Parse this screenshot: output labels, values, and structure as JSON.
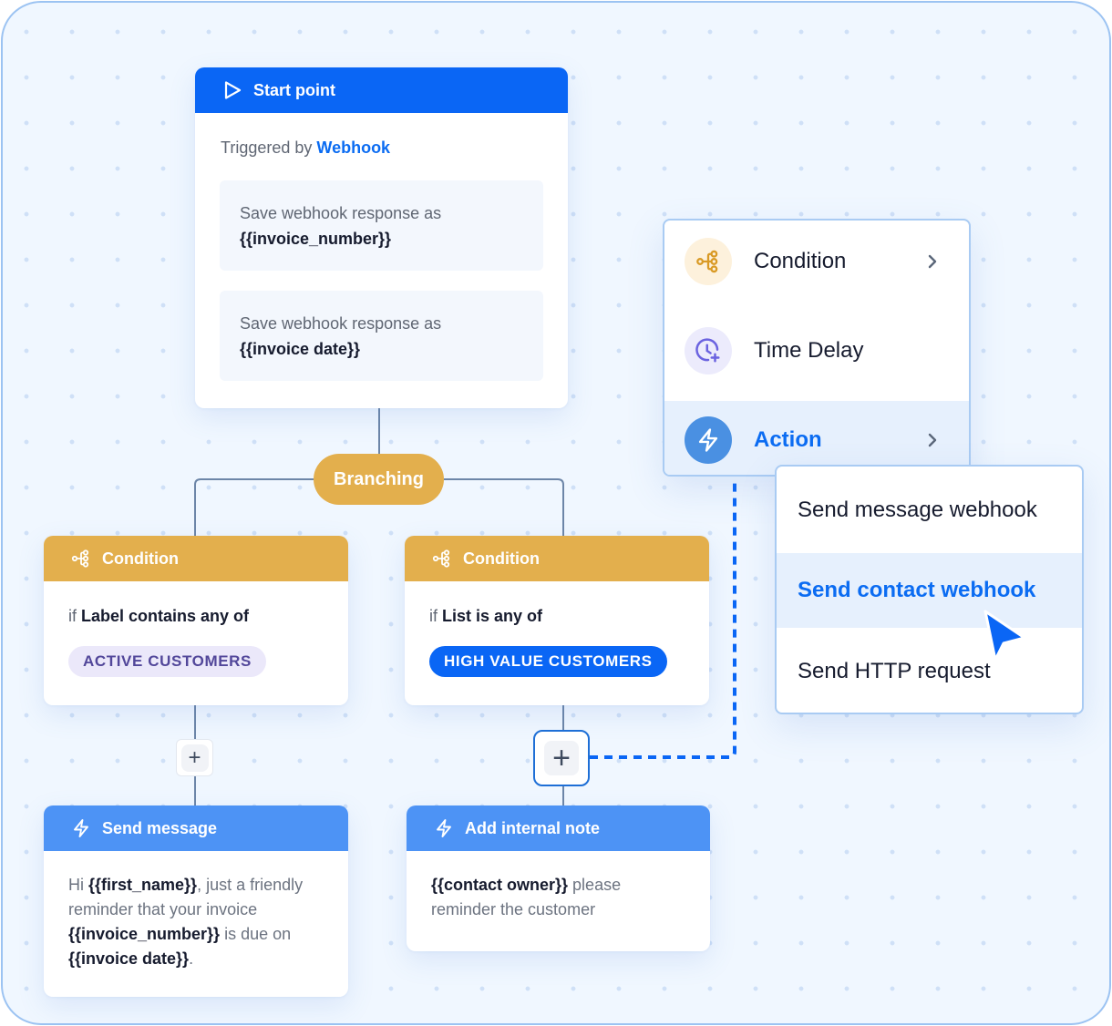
{
  "colors": {
    "primary_blue": "#0a66f5",
    "condition_gold": "#e3af4d",
    "action_blue": "#4d93f5",
    "link_blue": "#0b6cf2",
    "connector": "#6d86a8",
    "dashed_connector": "#0a66f5"
  },
  "start_point": {
    "icon": "play-icon",
    "title": "Start point",
    "triggered_prefix": "Triggered by",
    "trigger_source": "Webhook",
    "save_rules": [
      {
        "label": "Save webhook response as",
        "variable": "{{invoice_number}}"
      },
      {
        "label": "Save webhook response as",
        "variable": "{{invoice date}}"
      }
    ]
  },
  "branching": {
    "label": "Branching"
  },
  "conditions": [
    {
      "icon": "branch-icon",
      "title": "Condition",
      "if_word": "if",
      "rule": "Label contains any of",
      "tag": "ACTIVE CUSTOMERS",
      "tag_style": "purple"
    },
    {
      "icon": "branch-icon",
      "title": "Condition",
      "if_word": "if",
      "rule": "List is any of",
      "tag": "HIGH VALUE CUSTOMERS",
      "tag_style": "blue"
    }
  ],
  "add_buttons": [
    {
      "symbol": "+",
      "state": "default"
    },
    {
      "symbol": "+",
      "state": "active"
    }
  ],
  "actions": [
    {
      "icon": "lightning-icon",
      "title": "Send message",
      "body": [
        {
          "text": "Hi ",
          "bold": false
        },
        {
          "text": "{{first_name}}",
          "bold": true
        },
        {
          "text": ", just a friendly reminder that your invoice ",
          "bold": false
        },
        {
          "text": "{{invoice_number}}",
          "bold": true
        },
        {
          "text": " is due on ",
          "bold": false
        },
        {
          "text": "{{invoice date}}",
          "bold": true
        },
        {
          "text": ".",
          "bold": false
        }
      ]
    },
    {
      "icon": "lightning-icon",
      "title": "Add internal note",
      "body": [
        {
          "text": "{{contact owner}}",
          "bold": true
        },
        {
          "text": " please reminder the customer",
          "bold": false
        }
      ]
    }
  ],
  "node_menu": {
    "items": [
      {
        "icon": "branch-icon",
        "label": "Condition",
        "has_submenu": true,
        "active": false
      },
      {
        "icon": "clock-plus-icon",
        "label": "Time Delay",
        "has_submenu": false,
        "active": false
      },
      {
        "icon": "lightning-icon",
        "label": "Action",
        "has_submenu": true,
        "active": true
      }
    ]
  },
  "action_submenu": {
    "items": [
      {
        "label": "Send message webhook",
        "hovered": false
      },
      {
        "label": "Send contact webhook",
        "hovered": true
      },
      {
        "label": "Send HTTP request",
        "hovered": false
      }
    ]
  }
}
